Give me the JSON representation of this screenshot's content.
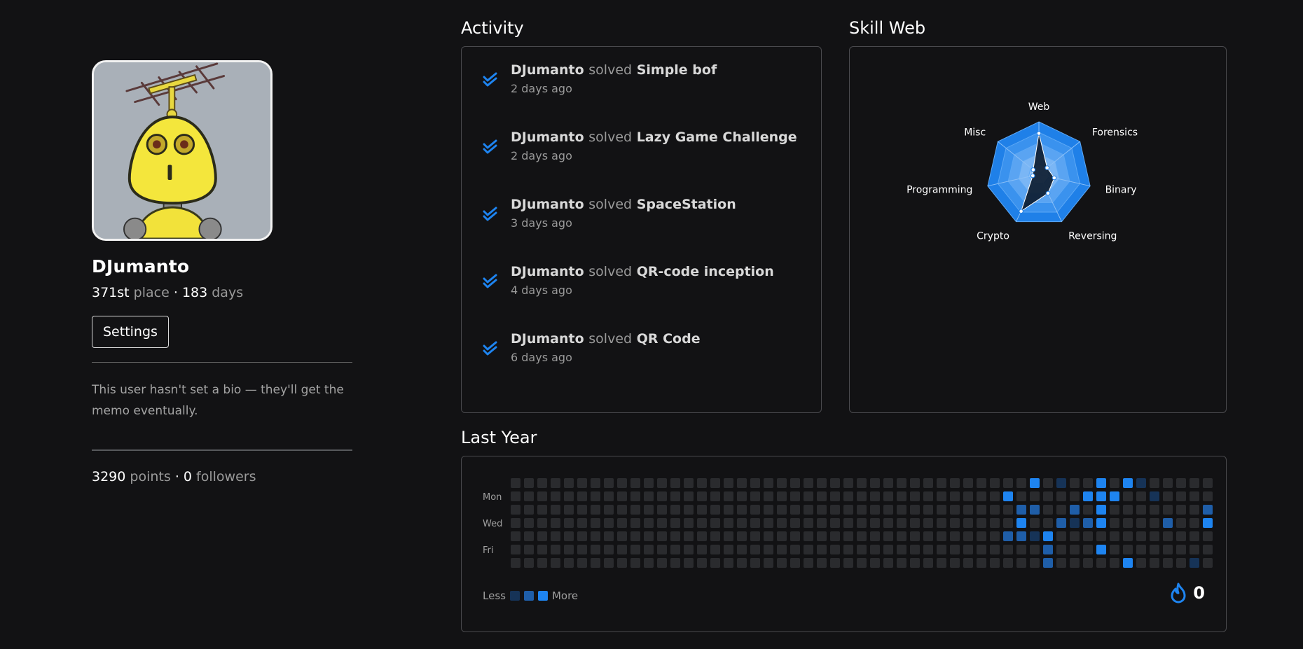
{
  "profile": {
    "username": "DJumanto",
    "rank": "371st",
    "rank_suffix": "place",
    "separator": "·",
    "days": "183",
    "days_suffix": "days",
    "settings_label": "Settings",
    "bio": "This user hasn't set a bio — they'll get the memo eventually.",
    "points": "3290",
    "points_suffix": "points",
    "followers": "0",
    "followers_suffix": "followers"
  },
  "activity": {
    "title": "Activity",
    "verb": "solved",
    "items": [
      {
        "user": "DJumanto",
        "challenge": "Simple bof",
        "time": "2 days ago"
      },
      {
        "user": "DJumanto",
        "challenge": "Lazy Game Challenge",
        "time": "2 days ago"
      },
      {
        "user": "DJumanto",
        "challenge": "SpaceStation",
        "time": "3 days ago"
      },
      {
        "user": "DJumanto",
        "challenge": "QR-code inception",
        "time": "4 days ago"
      },
      {
        "user": "DJumanto",
        "challenge": "QR Code",
        "time": "6 days ago"
      }
    ]
  },
  "skill_web": {
    "title": "Skill Web",
    "axes": [
      "Web",
      "Forensics",
      "Binary",
      "Reversing",
      "Crypto",
      "Programming",
      "Misc"
    ],
    "values": [
      0.78,
      0.2,
      0.3,
      0.4,
      0.78,
      0.12,
      0.14
    ],
    "colors": {
      "outer": "#1f7fe6",
      "fill": "#0b1a2c",
      "line": "#ffffff"
    }
  },
  "last_year": {
    "title": "Last Year",
    "day_labels": [
      "Mon",
      "Wed",
      "Fri"
    ],
    "legend_less": "Less",
    "legend_more": "More",
    "streak": "0",
    "colors": {
      "empty": "#2a2b2e",
      "low": "#163357",
      "mid": "#1f5ea8",
      "high": "#1e84f0"
    },
    "active_cells": [
      {
        "week": 38,
        "day": 3,
        "level": 3
      },
      {
        "week": 38,
        "day": 4,
        "level": 2
      },
      {
        "week": 37,
        "day": 4,
        "level": 2
      },
      {
        "week": 37,
        "day": 1,
        "level": 3
      },
      {
        "week": 38,
        "day": 2,
        "level": 2
      },
      {
        "week": 39,
        "day": 2,
        "level": 2
      },
      {
        "week": 39,
        "day": 0,
        "level": 3
      },
      {
        "week": 39,
        "day": 4,
        "level": 1
      },
      {
        "week": 40,
        "day": 4,
        "level": 3
      },
      {
        "week": 40,
        "day": 5,
        "level": 2
      },
      {
        "week": 40,
        "day": 6,
        "level": 2
      },
      {
        "week": 41,
        "day": 0,
        "level": 1
      },
      {
        "week": 41,
        "day": 3,
        "level": 2
      },
      {
        "week": 42,
        "day": 2,
        "level": 2
      },
      {
        "week": 42,
        "day": 3,
        "level": 1
      },
      {
        "week": 43,
        "day": 1,
        "level": 3
      },
      {
        "week": 43,
        "day": 3,
        "level": 2
      },
      {
        "week": 44,
        "day": 0,
        "level": 3
      },
      {
        "week": 44,
        "day": 1,
        "level": 3
      },
      {
        "week": 44,
        "day": 2,
        "level": 3
      },
      {
        "week": 44,
        "day": 3,
        "level": 3
      },
      {
        "week": 44,
        "day": 5,
        "level": 3
      },
      {
        "week": 45,
        "day": 1,
        "level": 3
      },
      {
        "week": 46,
        "day": 0,
        "level": 3
      },
      {
        "week": 46,
        "day": 6,
        "level": 3
      },
      {
        "week": 47,
        "day": 0,
        "level": 1
      },
      {
        "week": 49,
        "day": 3,
        "level": 2
      },
      {
        "week": 51,
        "day": 6,
        "level": 1
      },
      {
        "week": 52,
        "day": 2,
        "level": 2
      },
      {
        "week": 52,
        "day": 3,
        "level": 3
      },
      {
        "week": 48,
        "day": 1,
        "level": 1
      }
    ]
  }
}
